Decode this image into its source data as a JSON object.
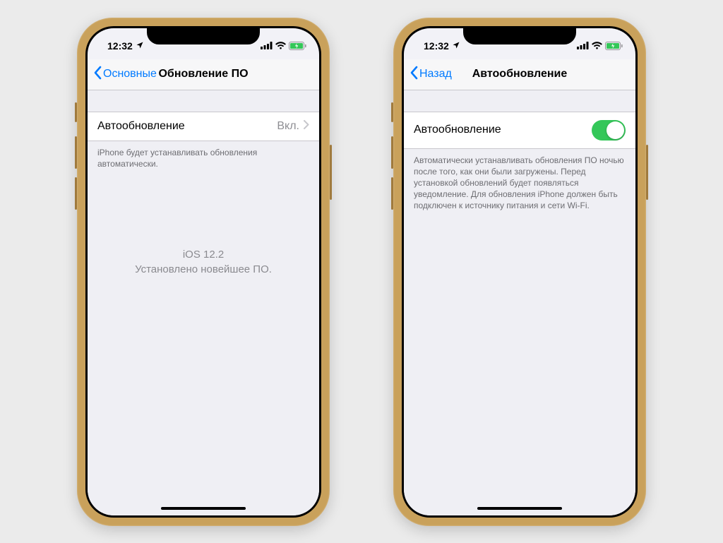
{
  "status": {
    "time": "12:32"
  },
  "left_screen": {
    "back_label": "Основные",
    "title": "Обновление ПО",
    "row": {
      "label": "Автообновление",
      "value": "Вкл."
    },
    "footer": "iPhone будет устанавливать обновления автоматически.",
    "center_line1": "iOS 12.2",
    "center_line2": "Установлено новейшее ПО."
  },
  "right_screen": {
    "back_label": "Назад",
    "title": "Автообновление",
    "row": {
      "label": "Автообновление",
      "toggle_on": true
    },
    "footer": "Автоматически устанавливать обновления ПО ночью после того, как они были загружены. Перед установкой обновлений будет появляться уведомление. Для обновления iPhone должен быть подключен к источнику питания и сети Wi-Fi."
  }
}
